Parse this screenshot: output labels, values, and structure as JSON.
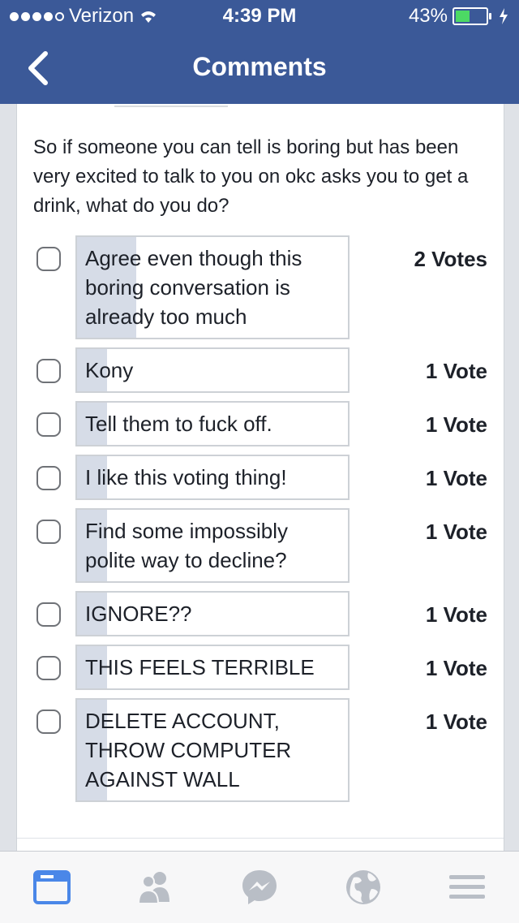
{
  "status_bar": {
    "carrier": "Verizon",
    "time": "4:39 PM",
    "battery": "43%",
    "battery_level": 0.43
  },
  "nav": {
    "title": "Comments",
    "back_icon": "chevron-left-icon"
  },
  "question": "So if someone you can tell is boring but has been very excited to talk to you on okc asks you to get a drink, what do you do?",
  "options": [
    {
      "label": "Agree even though this boring conversation is already too much",
      "votes": "2 Votes",
      "share": 0.22
    },
    {
      "label": "Kony",
      "votes": "1 Vote",
      "share": 0.11
    },
    {
      "label": "Tell them to fuck off.",
      "votes": "1 Vote",
      "share": 0.11
    },
    {
      "label": "I like this voting thing!",
      "votes": "1 Vote",
      "share": 0.11
    },
    {
      "label": "Find some impossibly polite way to decline?",
      "votes": "1 Vote",
      "share": 0.11
    },
    {
      "label": "IGNORE??",
      "votes": "1 Vote",
      "share": 0.11
    },
    {
      "label": "THIS FEELS TERRIBLE",
      "votes": "1 Vote",
      "share": 0.11
    },
    {
      "label": "DELETE ACCOUNT, THROW COMPUTER AGAINST WALL",
      "votes": "1 Vote",
      "share": 0.11
    }
  ],
  "tabs": [
    {
      "icon": "news-feed-icon",
      "active": true
    },
    {
      "icon": "friends-icon",
      "active": false
    },
    {
      "icon": "messenger-icon",
      "active": false
    },
    {
      "icon": "globe-icon",
      "active": false
    },
    {
      "icon": "menu-icon",
      "active": false
    }
  ],
  "colors": {
    "brand": "#3b5998",
    "active_tab": "#4a87e8",
    "inactive_tab": "#b9bec6",
    "vote_fill": "#d6dce7"
  }
}
